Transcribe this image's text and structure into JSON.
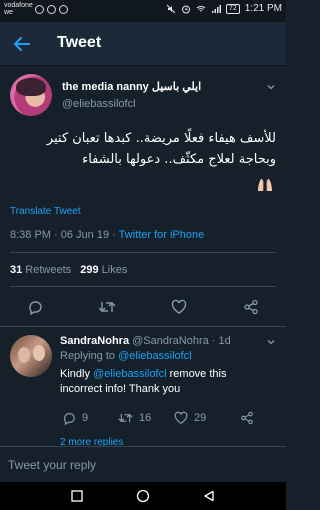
{
  "status_bar": {
    "carrier_line1": "vodafone",
    "carrier_line2": "we",
    "time": "1:21 PM",
    "battery": "72"
  },
  "header": {
    "title": "Tweet",
    "back_icon": "arrow-left-icon"
  },
  "tweet": {
    "author_name": "the media nanny ايلي باسيل",
    "author_handle": "@eliebassilofcl",
    "text": "للأسف هيفاء فعلًا مريضة.. كبدها تعبان كتير وبحاجة لعلاج مكثّف.. دعولها بالشفاء",
    "translate_label": "Translate Tweet",
    "timestamp": "8:38 PM · 06 Jun 19 · ",
    "source": "Twitter for iPhone",
    "retweet_count": "31",
    "retweet_label": " Retweets",
    "like_count": "299",
    "like_label": " Likes",
    "colors": {
      "link": "#1da1f2",
      "muted": "#8899a6",
      "background": "#15202b"
    }
  },
  "reply": {
    "name": "SandraNohra",
    "handle": "@SandraNohra",
    "time": " · 1d",
    "replying_prefix": "Replying to ",
    "replying_handle": "@eliebassilofcl",
    "text_before": "Kindly ",
    "mention": "@eliebassilofcl",
    "text_after": " remove this incorrect info! Thank you",
    "reply_count": "9",
    "retweet_count": "16",
    "like_count": "29",
    "more_replies": "2 more replies"
  },
  "compose": {
    "placeholder": "Tweet your reply"
  }
}
